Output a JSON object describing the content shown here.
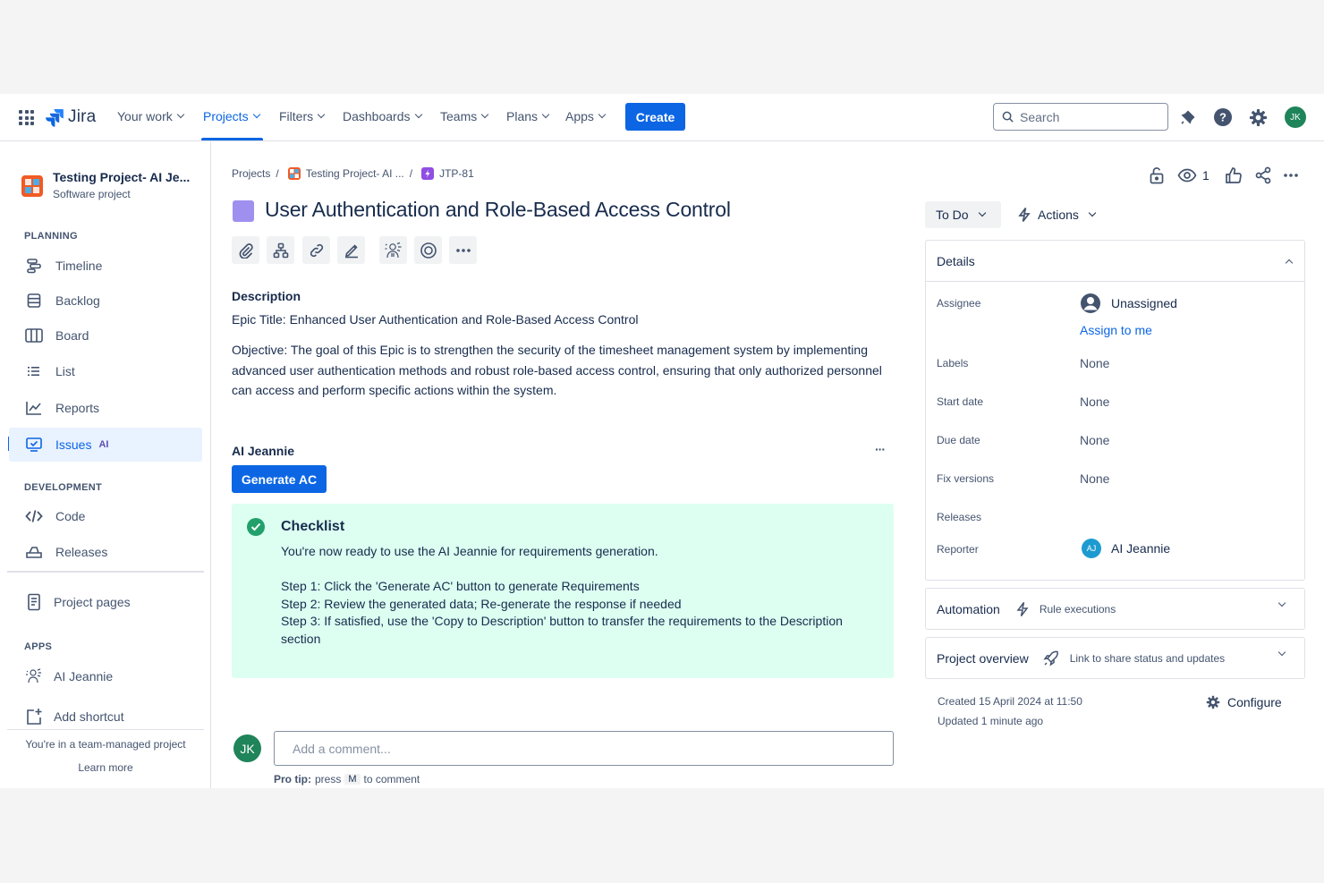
{
  "nav": {
    "product": "Jira",
    "items": [
      {
        "label": "Your work",
        "active": false
      },
      {
        "label": "Projects",
        "active": true
      },
      {
        "label": "Filters",
        "active": false
      },
      {
        "label": "Dashboards",
        "active": false
      },
      {
        "label": "Teams",
        "active": false
      },
      {
        "label": "Plans",
        "active": false
      },
      {
        "label": "Apps",
        "active": false
      }
    ],
    "create_label": "Create",
    "search_placeholder": "Search",
    "user_initials": "JK",
    "accent_color": "#0c66e4"
  },
  "sidebar": {
    "project_name": "Testing Project- AI Je...",
    "project_type": "Software project",
    "planning_title": "PLANNING",
    "planning_items": [
      {
        "label": "Timeline",
        "icon": "timeline-icon"
      },
      {
        "label": "Backlog",
        "icon": "backlog-icon"
      },
      {
        "label": "Board",
        "icon": "board-icon"
      },
      {
        "label": "List",
        "icon": "list-icon"
      },
      {
        "label": "Reports",
        "icon": "reports-icon"
      },
      {
        "label": "Issues",
        "icon": "issues-icon",
        "badge": "AI",
        "active": true
      }
    ],
    "development_title": "DEVELOPMENT",
    "development_items": [
      {
        "label": "Code",
        "icon": "code-icon"
      },
      {
        "label": "Releases",
        "icon": "releases-icon"
      }
    ],
    "project_pages": "Project pages",
    "apps_title": "APPS",
    "apps_items": [
      {
        "label": "AI Jeannie",
        "icon": "ai-jeannie-icon"
      },
      {
        "label": "Add shortcut",
        "icon": "add-shortcut-icon"
      }
    ],
    "team_note": "You're in a team-managed project",
    "learn_more": "Learn more"
  },
  "breadcrumb": {
    "projects": "Projects",
    "project": "Testing Project- AI ...",
    "issue_key": "JTP-81",
    "separator": "/"
  },
  "issue": {
    "title": "User Authentication and Role-Based Access Control",
    "epic_color": "#9f8fef",
    "description_label": "Description",
    "epic_title_line": "Epic Title: Enhanced User Authentication and Role-Based Access Control",
    "objective": "Objective: The goal of this Epic is to strengthen the security of the timesheet management system by implementing advanced user authentication methods and robust role-based access control, ensuring that only authorized personnel can access and perform specific actions within the system.",
    "toolbar_icons": [
      "attachment-icon",
      "child-issue-icon",
      "link-icon",
      "edit-icon",
      "ai-jeannie-icon",
      "target-icon",
      "more-icon"
    ]
  },
  "ai_jeannie": {
    "heading": "AI Jeannie",
    "more": "···",
    "generate_label": "Generate AC",
    "checklist_title": "Checklist",
    "ready_text": "You're now ready to use the AI Jeannie for requirements generation.",
    "step1": "Step 1: Click the 'Generate AC' button to generate Requirements",
    "step2": "Step 2: Review the generated data; Re-generate the response if needed",
    "step3": "Step 3: If satisfied, use the 'Copy to Description' button to transfer the requirements to the Description section",
    "checklist_bg": "#dcfff1"
  },
  "comment": {
    "avatar": "JK",
    "placeholder": "Add a comment...",
    "tip_prefix": "Pro tip:",
    "tip_press": "press",
    "tip_key": "M",
    "tip_suffix": "to comment"
  },
  "right": {
    "watchers": "1",
    "status": "To Do",
    "actions": "Actions",
    "details_title": "Details",
    "assignee_label": "Assignee",
    "assignee_value": "Unassigned",
    "assign_to_me": "Assign to me",
    "labels_label": "Labels",
    "labels_value": "None",
    "start_label": "Start date",
    "start_value": "None",
    "due_label": "Due date",
    "due_value": "None",
    "fix_label": "Fix versions",
    "fix_value": "None",
    "releases_label": "Releases",
    "reporter_label": "Reporter",
    "reporter_initials": "AJ",
    "reporter_value": "AI Jeannie",
    "automation_title": "Automation",
    "automation_sub": "Rule executions",
    "overview_title": "Project overview",
    "overview_sub": "Link to share status and updates",
    "created": "Created 15 April 2024 at 11:50",
    "updated": "Updated 1 minute ago",
    "configure": "Configure"
  }
}
